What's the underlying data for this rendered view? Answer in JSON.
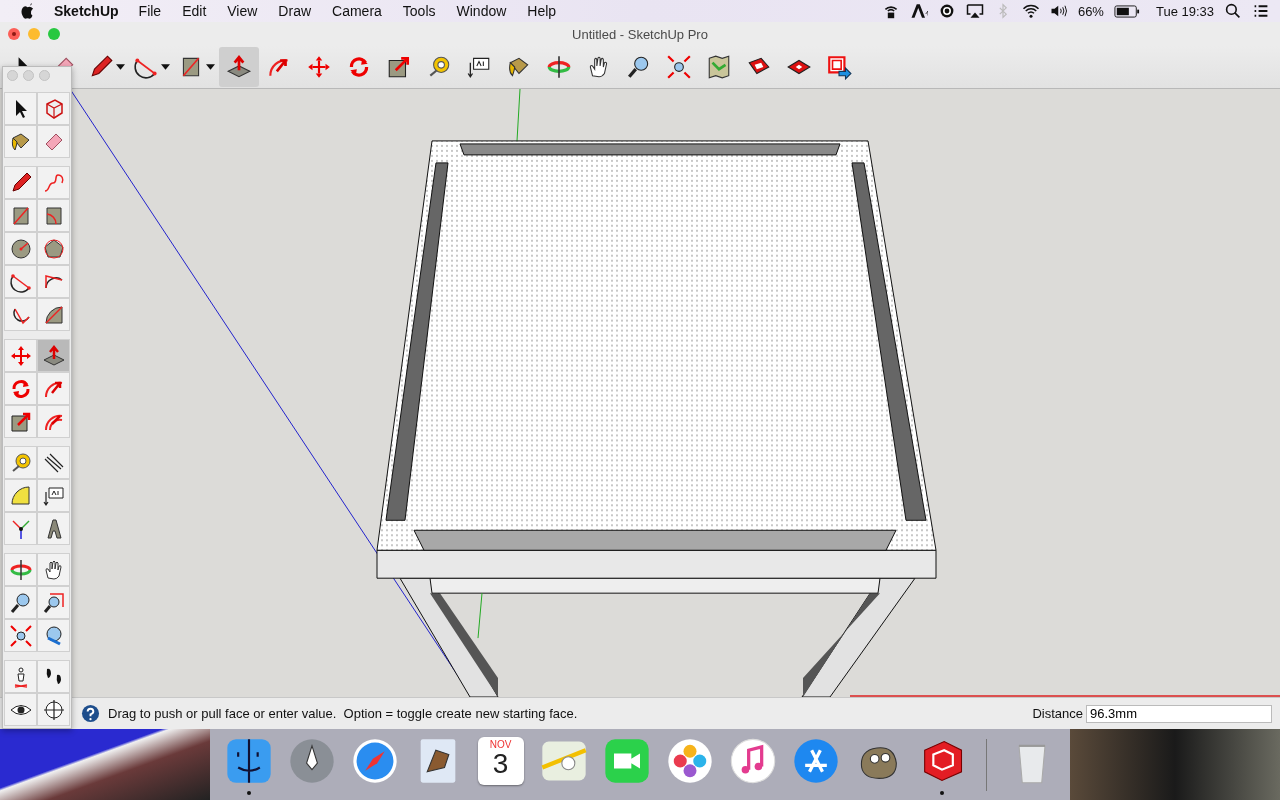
{
  "menubar": {
    "app_name": "SketchUp",
    "menus": [
      "File",
      "Edit",
      "View",
      "Draw",
      "Camera",
      "Tools",
      "Window",
      "Help"
    ],
    "battery": "66%",
    "clock": "Tue 19:33"
  },
  "window": {
    "title": "Untitled - SketchUp Pro"
  },
  "toolbar": [
    {
      "kind": "select",
      "selected": false,
      "dropdown": false
    },
    {
      "kind": "eraser",
      "selected": false,
      "dropdown": false
    },
    {
      "kind": "pencil",
      "selected": false,
      "dropdown": true
    },
    {
      "kind": "arc",
      "selected": false,
      "dropdown": true
    },
    {
      "kind": "rect",
      "selected": false,
      "dropdown": true
    },
    {
      "kind": "pushpull",
      "selected": true,
      "dropdown": false
    },
    {
      "kind": "followme",
      "selected": false,
      "dropdown": false
    },
    {
      "kind": "move",
      "selected": false,
      "dropdown": false
    },
    {
      "kind": "rotate",
      "selected": false,
      "dropdown": false
    },
    {
      "kind": "scale",
      "selected": false,
      "dropdown": false
    },
    {
      "kind": "tape",
      "selected": false,
      "dropdown": false
    },
    {
      "kind": "text",
      "selected": false,
      "dropdown": false
    },
    {
      "kind": "paint",
      "selected": false,
      "dropdown": false
    },
    {
      "kind": "orbit",
      "selected": false,
      "dropdown": false
    },
    {
      "kind": "pan",
      "selected": false,
      "dropdown": false
    },
    {
      "kind": "zoom",
      "selected": false,
      "dropdown": false
    },
    {
      "kind": "zoomext",
      "selected": false,
      "dropdown": false
    },
    {
      "kind": "map",
      "selected": false,
      "dropdown": false
    },
    {
      "kind": "warehouse",
      "selected": false,
      "dropdown": false
    },
    {
      "kind": "extension",
      "selected": false,
      "dropdown": false
    },
    {
      "kind": "export",
      "selected": false,
      "dropdown": false
    }
  ],
  "tool_palette": [
    [
      {
        "kind": "select",
        "selected": false
      },
      {
        "kind": "component",
        "selected": false
      },
      {
        "kind": "paint",
        "selected": false
      },
      {
        "kind": "eraser",
        "selected": false
      }
    ],
    [
      {
        "kind": "pencil",
        "selected": false
      },
      {
        "kind": "freehand",
        "selected": false
      },
      {
        "kind": "rect",
        "selected": false
      },
      {
        "kind": "rotrect",
        "selected": false
      },
      {
        "kind": "circle",
        "selected": false
      },
      {
        "kind": "polygon",
        "selected": false
      },
      {
        "kind": "arc",
        "selected": false
      },
      {
        "kind": "arc2",
        "selected": false
      },
      {
        "kind": "arc3",
        "selected": false
      },
      {
        "kind": "pie",
        "selected": false
      }
    ],
    [
      {
        "kind": "move",
        "selected": false
      },
      {
        "kind": "pushpull",
        "selected": true
      },
      {
        "kind": "rotate",
        "selected": false
      },
      {
        "kind": "followme",
        "selected": false
      },
      {
        "kind": "scale",
        "selected": false
      },
      {
        "kind": "offset",
        "selected": false
      }
    ],
    [
      {
        "kind": "tape",
        "selected": false
      },
      {
        "kind": "dimension",
        "selected": false
      },
      {
        "kind": "protractor",
        "selected": false
      },
      {
        "kind": "text",
        "selected": false
      },
      {
        "kind": "axes",
        "selected": false
      },
      {
        "kind": "text3d",
        "selected": false
      }
    ],
    [
      {
        "kind": "orbit",
        "selected": false
      },
      {
        "kind": "pan",
        "selected": false
      },
      {
        "kind": "zoom",
        "selected": false
      },
      {
        "kind": "zoomwin",
        "selected": false
      },
      {
        "kind": "zoomext",
        "selected": false
      },
      {
        "kind": "previous",
        "selected": false
      }
    ],
    [
      {
        "kind": "position",
        "selected": false
      },
      {
        "kind": "walk",
        "selected": false
      },
      {
        "kind": "look",
        "selected": false
      },
      {
        "kind": "section",
        "selected": false
      }
    ]
  ],
  "status_bar": {
    "hint": "Drag to push or pull face or enter value.  Option = toggle create new starting face.",
    "measurement_label": "Distance",
    "measurement_value": "96.3mm"
  },
  "dock": [
    {
      "kind": "finder",
      "running": true
    },
    {
      "kind": "launchpad",
      "running": false
    },
    {
      "kind": "safari",
      "running": false
    },
    {
      "kind": "mail",
      "running": false
    },
    {
      "kind": "calendar",
      "running": false,
      "month": "NOV",
      "day": "3"
    },
    {
      "kind": "maps",
      "running": false
    },
    {
      "kind": "facetime",
      "running": false
    },
    {
      "kind": "photos",
      "running": false
    },
    {
      "kind": "itunes",
      "running": false
    },
    {
      "kind": "appstore",
      "running": false
    },
    {
      "kind": "gimp",
      "running": false
    },
    {
      "kind": "sketchup",
      "running": true
    },
    {
      "kind": "trash",
      "running": false
    }
  ]
}
